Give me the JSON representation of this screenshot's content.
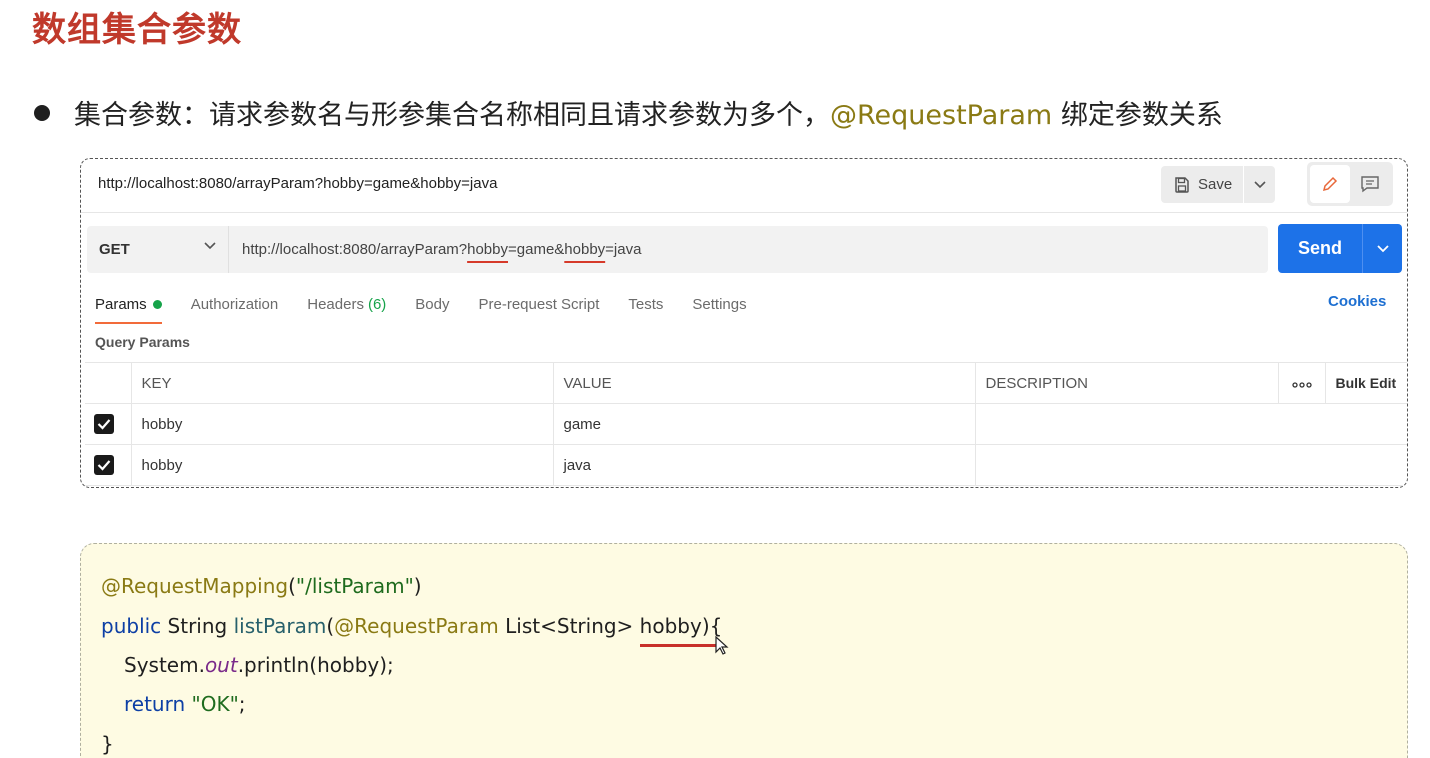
{
  "slide": {
    "title": "数组集合参数",
    "bullet_prefix": "集合参数：请求参数名与形参集合名称相同且请求参数为多个，",
    "bullet_highlight": "@RequestParam",
    "bullet_suffix": " 绑定参数关系"
  },
  "postman": {
    "top_url": "http://localhost:8080/arrayParam?hobby=game&hobby=java",
    "save_label": "Save",
    "method": "GET",
    "url_parts": [
      "http://localhost:8080/arrayParam?",
      "hobby",
      "=game&",
      "hobby",
      "=java"
    ],
    "send_label": "Send",
    "tabs": {
      "params": "Params",
      "authorization": "Authorization",
      "headers": "Headers",
      "headers_count": "(6)",
      "body": "Body",
      "prerequest": "Pre-request Script",
      "tests": "Tests",
      "settings": "Settings"
    },
    "cookies_label": "Cookies",
    "query_params_title": "Query Params",
    "table": {
      "headers": [
        "KEY",
        "VALUE",
        "DESCRIPTION",
        "ooo",
        "Bulk Edit"
      ],
      "rows": [
        {
          "key": "hobby",
          "value": "game",
          "description": ""
        },
        {
          "key": "hobby",
          "value": "java",
          "description": ""
        }
      ]
    }
  },
  "code": {
    "l1_ann": "@RequestMapping",
    "l1_open": "(",
    "l1_str": "\"/listParam\"",
    "l1_close": ")",
    "l2_kw": "public",
    "l2_type": " String ",
    "l2_fn": "listParam",
    "l2_open": "(",
    "l2_ann": "@RequestParam",
    "l2_rest": " List<String> hobby){",
    "l3_a": "System.",
    "l3_it": "out",
    "l3_b": ".println(hobby);",
    "l4_kw": "return",
    "l4_sp": " ",
    "l4_str": "\"OK\"",
    "l4_end": ";",
    "l5": "}"
  },
  "colors": {
    "title": "#c0392b",
    "send": "#1d72e8",
    "annotation": "#8a7a14",
    "keyword": "#0d3fa5",
    "underline": "#d63a2a"
  }
}
